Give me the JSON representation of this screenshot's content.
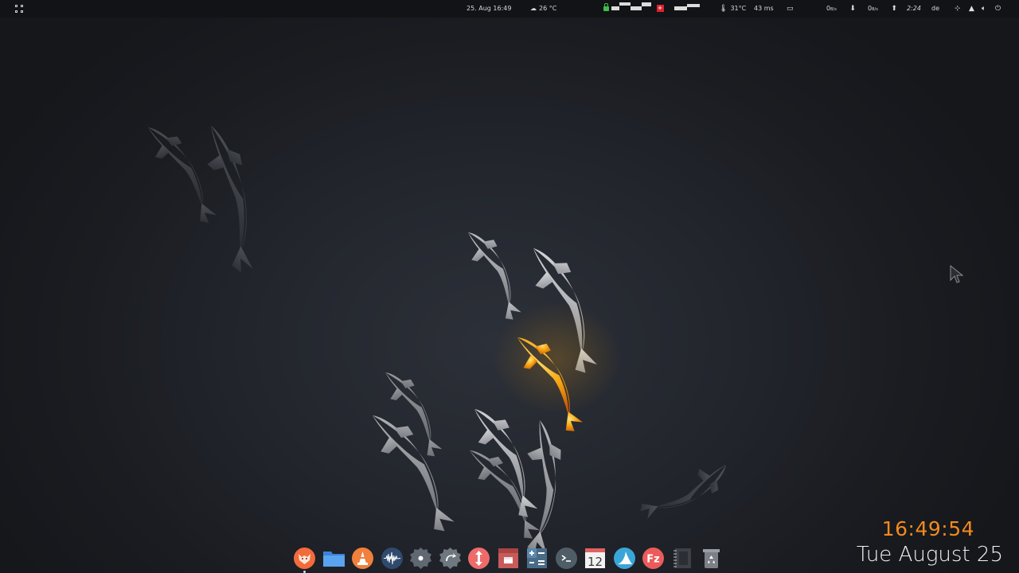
{
  "topbar": {
    "activities_icon": "app-grid-icon",
    "datetime": "25. Aug  16:49",
    "weather": {
      "icon": "cloud-sun-icon",
      "temp": "26 °C"
    },
    "vpn": {
      "icon": "lock-icon",
      "flag_icon": "swiss-flag-icon"
    },
    "cpu_temp": {
      "icon": "thermometer-icon",
      "value": "31°C"
    },
    "ping": "43 ms",
    "screen_icon": "screen-icon",
    "net_down": {
      "value": "0",
      "unit": "B/s",
      "icon": "download-arrow-icon"
    },
    "net_up": {
      "value": "0",
      "unit": "B/s",
      "icon": "upload-arrow-icon"
    },
    "battery_time": "2:24",
    "keyboard_layout": "de",
    "tray_icons": [
      "network-icon",
      "notification-bell-icon",
      "volume-icon",
      "power-icon"
    ]
  },
  "dock": {
    "items": [
      {
        "name": "firefox",
        "icon": "fox-icon",
        "active": true
      },
      {
        "name": "files",
        "icon": "folder-icon"
      },
      {
        "name": "vlc",
        "icon": "traffic-cone-icon"
      },
      {
        "name": "audio-editor",
        "icon": "waveform-icon"
      },
      {
        "name": "settings",
        "icon": "gear-icon"
      },
      {
        "name": "software-updater",
        "icon": "update-icon"
      },
      {
        "name": "transmission",
        "icon": "transfer-arrows-icon"
      },
      {
        "name": "archive-manager",
        "icon": "archive-box-icon"
      },
      {
        "name": "calculator",
        "icon": "calculator-icon"
      },
      {
        "name": "terminal",
        "icon": "terminal-icon"
      },
      {
        "name": "calendar",
        "icon": "calendar-icon",
        "label": "12"
      },
      {
        "name": "wireshark",
        "icon": "shark-fin-icon"
      },
      {
        "name": "filezilla",
        "icon": "filezilla-icon",
        "label": "Fz"
      },
      {
        "name": "notepad",
        "icon": "notebook-icon"
      },
      {
        "name": "trash",
        "icon": "recycle-bin-icon"
      }
    ]
  },
  "clock": {
    "time": "16:49:54",
    "date": "Tue August 25"
  },
  "colors": {
    "clock_time": "#f28a1e",
    "clock_date": "#f2f2f2",
    "panel_bg": "#121316",
    "desktop_bg": "#1e2026",
    "koi_gold": "#f5a30f",
    "koi_pale": "#c9cbce"
  }
}
